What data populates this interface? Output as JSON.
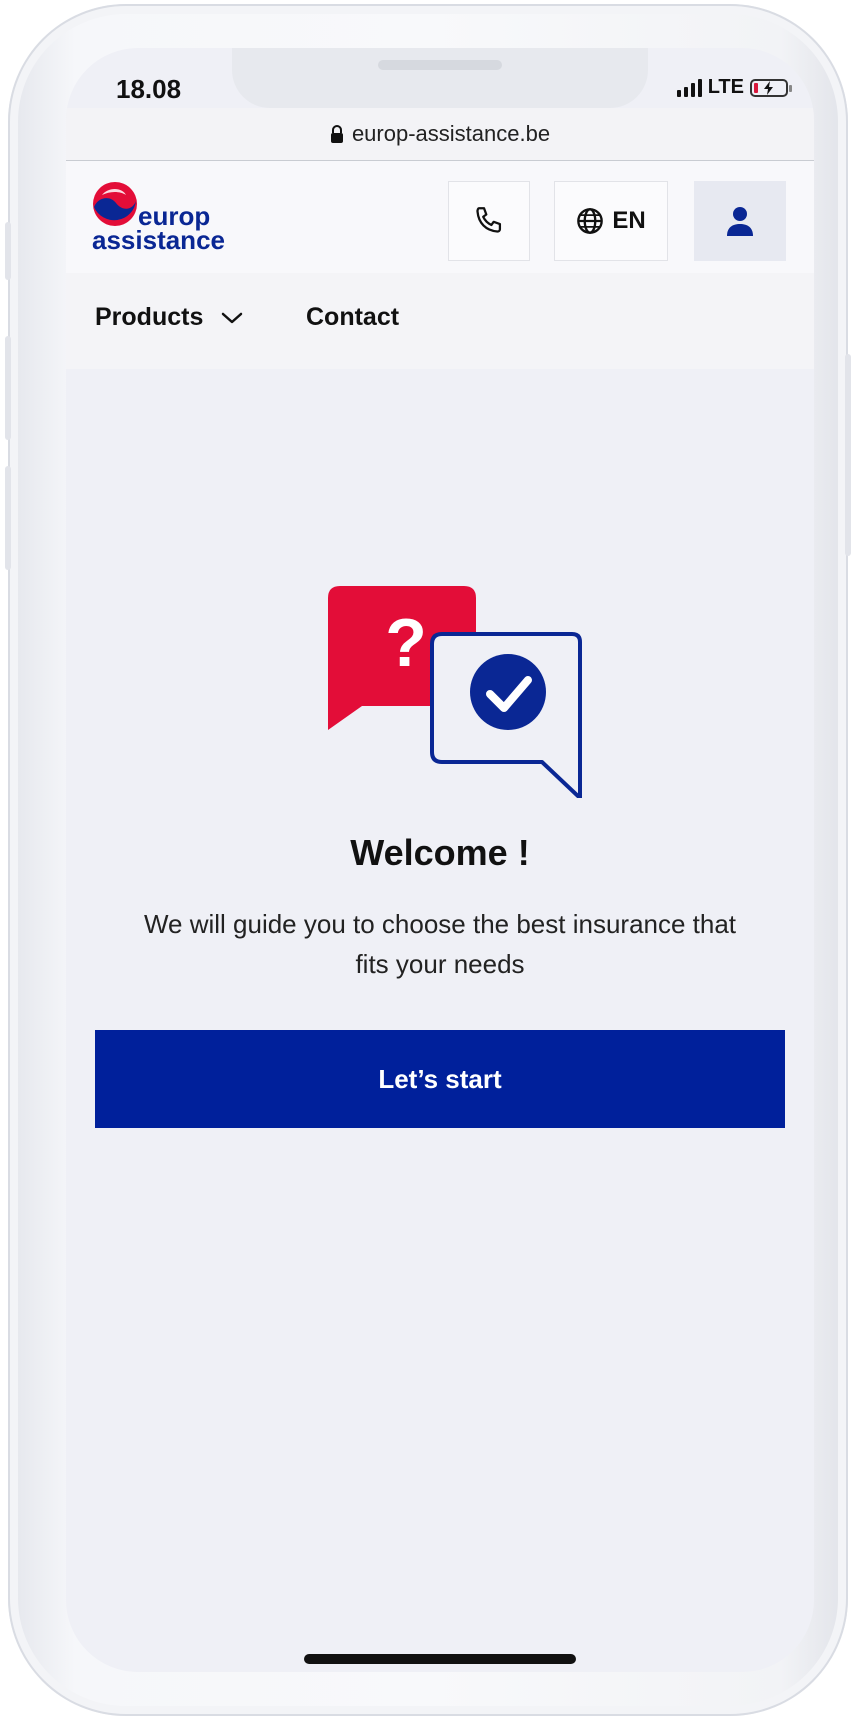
{
  "status_bar": {
    "time": "18.08",
    "network": "LTE"
  },
  "browser": {
    "url": "europ-assistance.be"
  },
  "header": {
    "logo_top": "europ",
    "logo_bottom": "assistance",
    "phone_icon": "phone-icon",
    "language": "EN",
    "language_icon": "globe-icon",
    "account_icon": "user-icon"
  },
  "nav": {
    "items": [
      {
        "label": "Products",
        "has_dropdown": true
      },
      {
        "label": "Contact"
      }
    ]
  },
  "main": {
    "illustration": "question-answer-chat-icon",
    "title": "Welcome !",
    "subtitle": "We will guide you to choose the best insurance that fits your needs",
    "cta_label": "Let’s start"
  },
  "colors": {
    "brand_blue": "#00209b",
    "brand_red": "#e30d38",
    "screen_bg": "#eff0f6"
  }
}
